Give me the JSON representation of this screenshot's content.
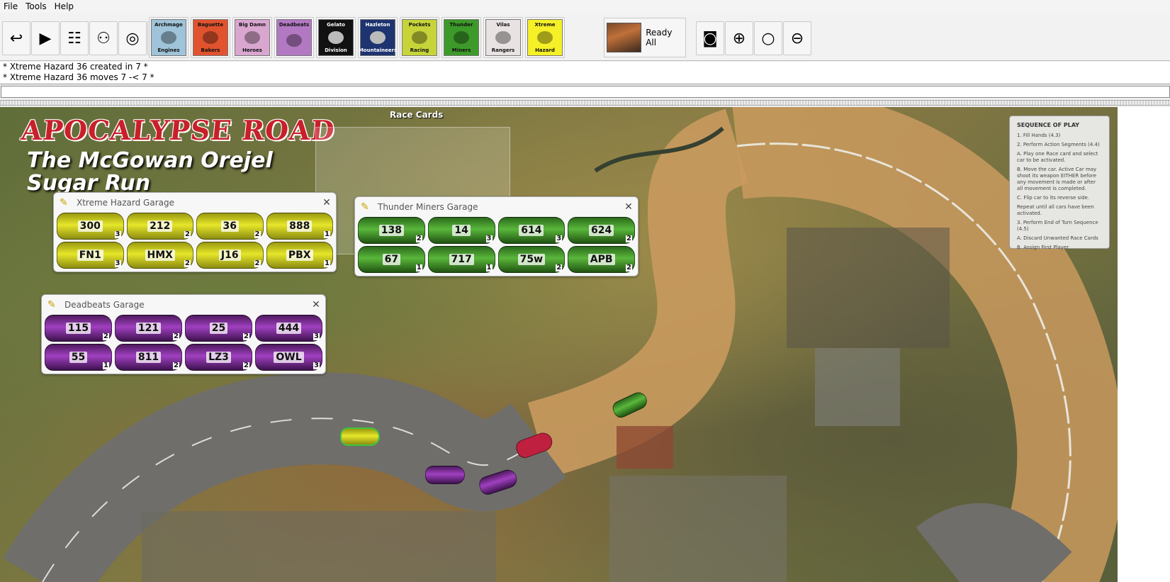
{
  "menu": {
    "file": "File",
    "tools": "Tools",
    "help": "Help"
  },
  "toolbar": {
    "tools": [
      {
        "name": "undo-icon",
        "glyph": "↩"
      },
      {
        "name": "step-forward-icon",
        "glyph": "▶"
      },
      {
        "name": "sliders-icon",
        "glyph": "☷"
      },
      {
        "name": "players-icon",
        "glyph": "⚇"
      },
      {
        "name": "coins-icon",
        "glyph": "◎"
      },
      {
        "name": "bag-icon",
        "glyph": "⛁"
      }
    ],
    "teams": [
      {
        "top": "Archmage",
        "bottom": "Engines",
        "color": "#9fc3d8"
      },
      {
        "top": "Baguette",
        "bottom": "Bakers",
        "color": "#e0532e"
      },
      {
        "top": "Big Damn",
        "bottom": "Heroes",
        "color": "#d9a6d0"
      },
      {
        "top": "Deadbeats",
        "bottom": "",
        "color": "#b279c2"
      },
      {
        "top": "Gelato",
        "bottom": "Division",
        "color": "#111111"
      },
      {
        "top": "Hazleton",
        "bottom": "Mountaineers",
        "color": "#1e3470"
      },
      {
        "top": "Pockets",
        "bottom": "Racing",
        "color": "#c6d43a"
      },
      {
        "top": "Thunder",
        "bottom": "Miners",
        "color": "#3d9a2a"
      },
      {
        "top": "Vilas",
        "bottom": "Rangers",
        "color": "#e9e2e2"
      },
      {
        "top": "Xtreme",
        "bottom": "Hazard",
        "color": "#f5f027"
      }
    ],
    "ready_all": "Ready All",
    "view_tools": [
      {
        "name": "camera-icon",
        "glyph": "◙"
      },
      {
        "name": "zoom-in-icon",
        "glyph": "⊕"
      },
      {
        "name": "zoom-icon",
        "glyph": "○"
      },
      {
        "name": "zoom-out-icon",
        "glyph": "⊖"
      }
    ]
  },
  "log": [
    "* Xtreme Hazard 36 created in 7 *",
    "* Xtreme Hazard 36 moves 7 -< 7 *"
  ],
  "board": {
    "title": "APOCALYPSE ROAD",
    "subtitle_1": "The McGowan Orejel",
    "subtitle_2": "Sugar Run",
    "race_cards_label": "Race Cards",
    "sequence": {
      "title": "SEQUENCE OF PLAY",
      "items": [
        "1. Fill Hands (4.3)",
        "2. Perform Action Segments (4.4)",
        "A. Play one Race card and select car to be activated.",
        "B. Move the car. Active Car may shoot its weapon EITHER before any movement is made or after all movement is completed.",
        "C. Flip car to its reverse side.",
        "Repeat until all cars have been activated.",
        "3. Perform End of Turn Sequence (4.5)",
        "A. Discard Unwanted Race Cards",
        "B. Assign First Player"
      ]
    }
  },
  "garages": {
    "xtreme": {
      "title": "Xtreme Hazard Garage",
      "cars": [
        {
          "num": "300",
          "count": "3"
        },
        {
          "num": "212",
          "count": "2"
        },
        {
          "num": "36",
          "count": "2"
        },
        {
          "num": "888",
          "count": "1"
        },
        {
          "num": "FN1",
          "count": "3"
        },
        {
          "num": "HMX",
          "count": "2"
        },
        {
          "num": "J16",
          "count": "2"
        },
        {
          "num": "PBX",
          "count": "1"
        }
      ]
    },
    "thunder": {
      "title": "Thunder Miners Garage",
      "cars": [
        {
          "num": "138",
          "count": "2"
        },
        {
          "num": "14",
          "count": "3"
        },
        {
          "num": "614",
          "count": "3"
        },
        {
          "num": "624",
          "count": "2"
        },
        {
          "num": "67",
          "count": "1"
        },
        {
          "num": "717",
          "count": "1"
        },
        {
          "num": "75w",
          "count": "2"
        },
        {
          "num": "APB",
          "count": "2"
        }
      ]
    },
    "deadbeats": {
      "title": "Deadbeats Garage",
      "cars": [
        {
          "num": "115",
          "count": "2"
        },
        {
          "num": "121",
          "count": "2"
        },
        {
          "num": "25",
          "count": "2"
        },
        {
          "num": "444",
          "count": "3"
        },
        {
          "num": "55",
          "count": "1"
        },
        {
          "num": "811",
          "count": "2"
        },
        {
          "num": "LZ3",
          "count": "2"
        },
        {
          "num": "OWL",
          "count": "3"
        }
      ]
    }
  }
}
